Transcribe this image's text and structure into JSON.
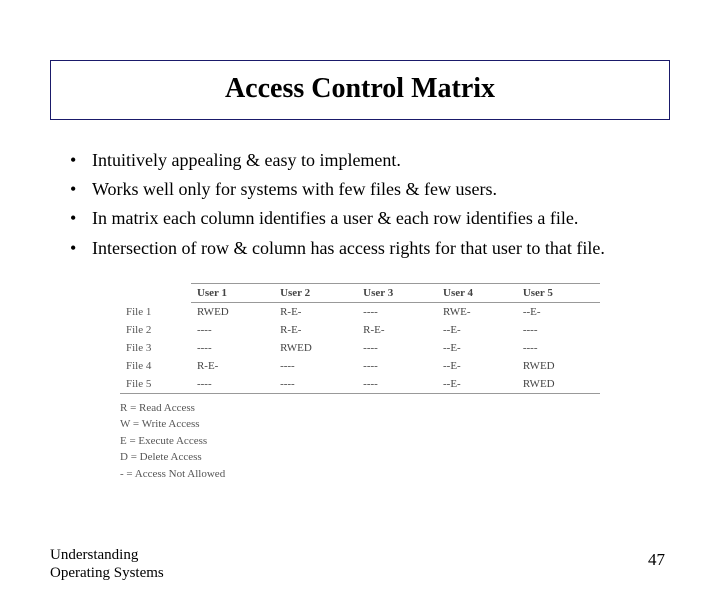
{
  "title": "Access Control Matrix",
  "bullets": [
    "Intuitively appealing & easy to implement.",
    "Works well only for systems with few files & few users.",
    "In matrix each column identifies a user & each row identifies a file.",
    "Intersection of row & column has access rights for that user to that file."
  ],
  "matrix": {
    "columns": [
      "User 1",
      "User 2",
      "User 3",
      "User 4",
      "User 5"
    ],
    "rows": [
      {
        "label": "File 1",
        "cells": [
          "RWED",
          "R-E-",
          "----",
          "RWE-",
          "--E-"
        ]
      },
      {
        "label": "File 2",
        "cells": [
          "----",
          "R-E-",
          "R-E-",
          "--E-",
          "----"
        ]
      },
      {
        "label": "File 3",
        "cells": [
          "----",
          "RWED",
          "----",
          "--E-",
          "----"
        ]
      },
      {
        "label": "File 4",
        "cells": [
          "R-E-",
          "----",
          "----",
          "--E-",
          "RWED"
        ]
      },
      {
        "label": "File 5",
        "cells": [
          "----",
          "----",
          "----",
          "--E-",
          "RWED"
        ]
      }
    ]
  },
  "legend": [
    "R = Read Access",
    "W = Write Access",
    "E = Execute Access",
    "D = Delete Access",
    "- = Access Not Allowed"
  ],
  "footer": {
    "line1": "Understanding",
    "line2": "Operating Systems"
  },
  "page_number": "47"
}
